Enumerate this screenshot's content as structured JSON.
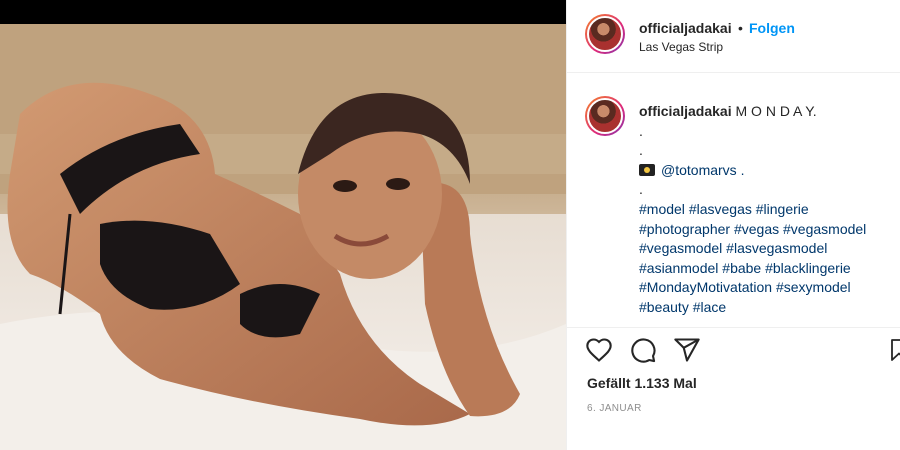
{
  "header": {
    "username": "officialjadakai",
    "separator": "•",
    "follow_label": "Folgen",
    "location": "Las Vegas Strip",
    "more": "⋮"
  },
  "caption": {
    "username": "officialjadakai",
    "headline": "M O N D A Y.",
    "dot1": ".",
    "dot2": ".",
    "mention": "@totomarvs .",
    "dot3": ".",
    "hashtag_lines": [
      [
        "#model",
        "#lasvegas",
        "#lingerie"
      ],
      [
        "#photographer",
        "#vegas",
        "#vegasmodel"
      ],
      [
        "#vegasmodel",
        "#lasvegasmodel"
      ],
      [
        "#asianmodel",
        "#babe",
        "#blacklingerie"
      ],
      [
        "#MondayMotivatation",
        "#sexymodel"
      ],
      [
        "#beauty",
        "#lace"
      ]
    ]
  },
  "actions": {
    "icons": [
      "heart-icon",
      "comment-icon",
      "share-icon",
      "bookmark-icon"
    ]
  },
  "likes_text": "Gefällt 1.133 Mal",
  "date_text": "6. JANUAR",
  "colors": {
    "accent_blue": "#0095f6",
    "link": "#00376b",
    "text": "#262626",
    "muted": "#8e8e8e"
  }
}
